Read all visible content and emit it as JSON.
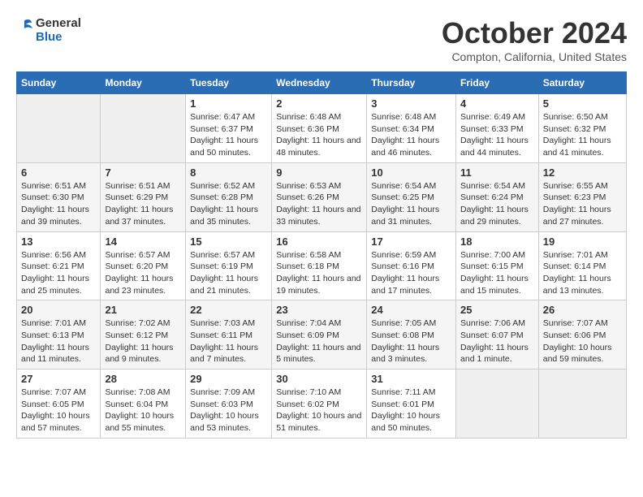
{
  "logo": {
    "general": "General",
    "blue": "Blue"
  },
  "title": "October 2024",
  "location": "Compton, California, United States",
  "weekdays": [
    "Sunday",
    "Monday",
    "Tuesday",
    "Wednesday",
    "Thursday",
    "Friday",
    "Saturday"
  ],
  "weeks": [
    [
      {
        "day": "",
        "sunrise": "",
        "sunset": "",
        "daylight": ""
      },
      {
        "day": "",
        "sunrise": "",
        "sunset": "",
        "daylight": ""
      },
      {
        "day": "1",
        "sunrise": "Sunrise: 6:47 AM",
        "sunset": "Sunset: 6:37 PM",
        "daylight": "Daylight: 11 hours and 50 minutes."
      },
      {
        "day": "2",
        "sunrise": "Sunrise: 6:48 AM",
        "sunset": "Sunset: 6:36 PM",
        "daylight": "Daylight: 11 hours and 48 minutes."
      },
      {
        "day": "3",
        "sunrise": "Sunrise: 6:48 AM",
        "sunset": "Sunset: 6:34 PM",
        "daylight": "Daylight: 11 hours and 46 minutes."
      },
      {
        "day": "4",
        "sunrise": "Sunrise: 6:49 AM",
        "sunset": "Sunset: 6:33 PM",
        "daylight": "Daylight: 11 hours and 44 minutes."
      },
      {
        "day": "5",
        "sunrise": "Sunrise: 6:50 AM",
        "sunset": "Sunset: 6:32 PM",
        "daylight": "Daylight: 11 hours and 41 minutes."
      }
    ],
    [
      {
        "day": "6",
        "sunrise": "Sunrise: 6:51 AM",
        "sunset": "Sunset: 6:30 PM",
        "daylight": "Daylight: 11 hours and 39 minutes."
      },
      {
        "day": "7",
        "sunrise": "Sunrise: 6:51 AM",
        "sunset": "Sunset: 6:29 PM",
        "daylight": "Daylight: 11 hours and 37 minutes."
      },
      {
        "day": "8",
        "sunrise": "Sunrise: 6:52 AM",
        "sunset": "Sunset: 6:28 PM",
        "daylight": "Daylight: 11 hours and 35 minutes."
      },
      {
        "day": "9",
        "sunrise": "Sunrise: 6:53 AM",
        "sunset": "Sunset: 6:26 PM",
        "daylight": "Daylight: 11 hours and 33 minutes."
      },
      {
        "day": "10",
        "sunrise": "Sunrise: 6:54 AM",
        "sunset": "Sunset: 6:25 PM",
        "daylight": "Daylight: 11 hours and 31 minutes."
      },
      {
        "day": "11",
        "sunrise": "Sunrise: 6:54 AM",
        "sunset": "Sunset: 6:24 PM",
        "daylight": "Daylight: 11 hours and 29 minutes."
      },
      {
        "day": "12",
        "sunrise": "Sunrise: 6:55 AM",
        "sunset": "Sunset: 6:23 PM",
        "daylight": "Daylight: 11 hours and 27 minutes."
      }
    ],
    [
      {
        "day": "13",
        "sunrise": "Sunrise: 6:56 AM",
        "sunset": "Sunset: 6:21 PM",
        "daylight": "Daylight: 11 hours and 25 minutes."
      },
      {
        "day": "14",
        "sunrise": "Sunrise: 6:57 AM",
        "sunset": "Sunset: 6:20 PM",
        "daylight": "Daylight: 11 hours and 23 minutes."
      },
      {
        "day": "15",
        "sunrise": "Sunrise: 6:57 AM",
        "sunset": "Sunset: 6:19 PM",
        "daylight": "Daylight: 11 hours and 21 minutes."
      },
      {
        "day": "16",
        "sunrise": "Sunrise: 6:58 AM",
        "sunset": "Sunset: 6:18 PM",
        "daylight": "Daylight: 11 hours and 19 minutes."
      },
      {
        "day": "17",
        "sunrise": "Sunrise: 6:59 AM",
        "sunset": "Sunset: 6:16 PM",
        "daylight": "Daylight: 11 hours and 17 minutes."
      },
      {
        "day": "18",
        "sunrise": "Sunrise: 7:00 AM",
        "sunset": "Sunset: 6:15 PM",
        "daylight": "Daylight: 11 hours and 15 minutes."
      },
      {
        "day": "19",
        "sunrise": "Sunrise: 7:01 AM",
        "sunset": "Sunset: 6:14 PM",
        "daylight": "Daylight: 11 hours and 13 minutes."
      }
    ],
    [
      {
        "day": "20",
        "sunrise": "Sunrise: 7:01 AM",
        "sunset": "Sunset: 6:13 PM",
        "daylight": "Daylight: 11 hours and 11 minutes."
      },
      {
        "day": "21",
        "sunrise": "Sunrise: 7:02 AM",
        "sunset": "Sunset: 6:12 PM",
        "daylight": "Daylight: 11 hours and 9 minutes."
      },
      {
        "day": "22",
        "sunrise": "Sunrise: 7:03 AM",
        "sunset": "Sunset: 6:11 PM",
        "daylight": "Daylight: 11 hours and 7 minutes."
      },
      {
        "day": "23",
        "sunrise": "Sunrise: 7:04 AM",
        "sunset": "Sunset: 6:09 PM",
        "daylight": "Daylight: 11 hours and 5 minutes."
      },
      {
        "day": "24",
        "sunrise": "Sunrise: 7:05 AM",
        "sunset": "Sunset: 6:08 PM",
        "daylight": "Daylight: 11 hours and 3 minutes."
      },
      {
        "day": "25",
        "sunrise": "Sunrise: 7:06 AM",
        "sunset": "Sunset: 6:07 PM",
        "daylight": "Daylight: 11 hours and 1 minute."
      },
      {
        "day": "26",
        "sunrise": "Sunrise: 7:07 AM",
        "sunset": "Sunset: 6:06 PM",
        "daylight": "Daylight: 10 hours and 59 minutes."
      }
    ],
    [
      {
        "day": "27",
        "sunrise": "Sunrise: 7:07 AM",
        "sunset": "Sunset: 6:05 PM",
        "daylight": "Daylight: 10 hours and 57 minutes."
      },
      {
        "day": "28",
        "sunrise": "Sunrise: 7:08 AM",
        "sunset": "Sunset: 6:04 PM",
        "daylight": "Daylight: 10 hours and 55 minutes."
      },
      {
        "day": "29",
        "sunrise": "Sunrise: 7:09 AM",
        "sunset": "Sunset: 6:03 PM",
        "daylight": "Daylight: 10 hours and 53 minutes."
      },
      {
        "day": "30",
        "sunrise": "Sunrise: 7:10 AM",
        "sunset": "Sunset: 6:02 PM",
        "daylight": "Daylight: 10 hours and 51 minutes."
      },
      {
        "day": "31",
        "sunrise": "Sunrise: 7:11 AM",
        "sunset": "Sunset: 6:01 PM",
        "daylight": "Daylight: 10 hours and 50 minutes."
      },
      {
        "day": "",
        "sunrise": "",
        "sunset": "",
        "daylight": ""
      },
      {
        "day": "",
        "sunrise": "",
        "sunset": "",
        "daylight": ""
      }
    ]
  ]
}
